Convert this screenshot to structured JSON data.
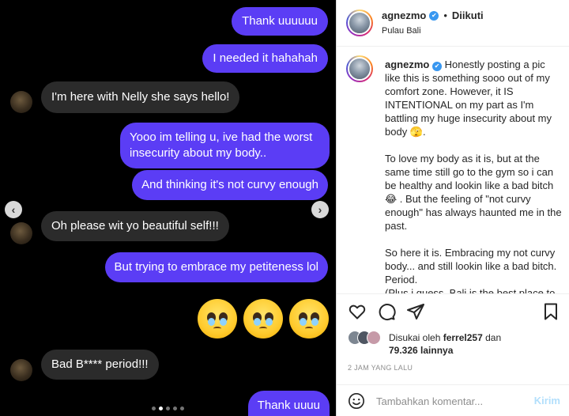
{
  "chat": {
    "messages": [
      {
        "from": "me",
        "text": "Thank uuuuuu"
      },
      {
        "from": "me",
        "text": "I needed it hahahah"
      },
      {
        "from": "them",
        "text": "I'm here with Nelly she says hello!"
      },
      {
        "from": "me",
        "text": "Yooo im telling u, ive had the worst insecurity about my body.."
      },
      {
        "from": "me",
        "text": "And thinking it's not curvy enough"
      },
      {
        "from": "them",
        "text": "Oh please wit yo beautiful self!!!"
      },
      {
        "from": "me",
        "text": "But trying to embrace my petiteness lol"
      },
      {
        "from": "them",
        "text": "Bad B**** period!!!"
      },
      {
        "from": "me",
        "text": "Thank uuuu"
      }
    ],
    "emoji_reaction": "pleading-face-emoji",
    "prev_arrow": "‹",
    "next_arrow": "›"
  },
  "post": {
    "username": "agnezmo",
    "separator": "•",
    "follow_status": "Diikuti",
    "location": "Pulau Bali",
    "more_label": "•••",
    "caption": {
      "username": "agnezmo",
      "paragraphs": [
        "Honestly posting a pic like this is something sooo out of my comfort zone. However, it IS INTENTIONAL on my part as I'm battling my huge insecurity about my body 🫣.",
        "To love my body as it is, but at the same time still go to the gym so i can be healthy and lookin like a bad bitch 😂 . But the feeling of \"not curvy enough\" has always haunted me in the past.",
        "So here it is. Embracing my not curvy body... and still lookin like a bad bitch. Period.\n(Plus i guess, Bali is the best place to"
      ]
    },
    "likes": {
      "prefix": "Disukai oleh",
      "user": "ferrel257",
      "middle": "dan",
      "count": "79.326 lainnya"
    },
    "timestamp": "2 JAM YANG LALU",
    "comment": {
      "placeholder": "Tambahkan komentar...",
      "post_label": "Kirim"
    }
  },
  "colors": {
    "my_bubble": "#5b3df5",
    "their_bubble": "#2b2b2b",
    "verified": "#3897f0",
    "post_button": "#b2dffc"
  }
}
